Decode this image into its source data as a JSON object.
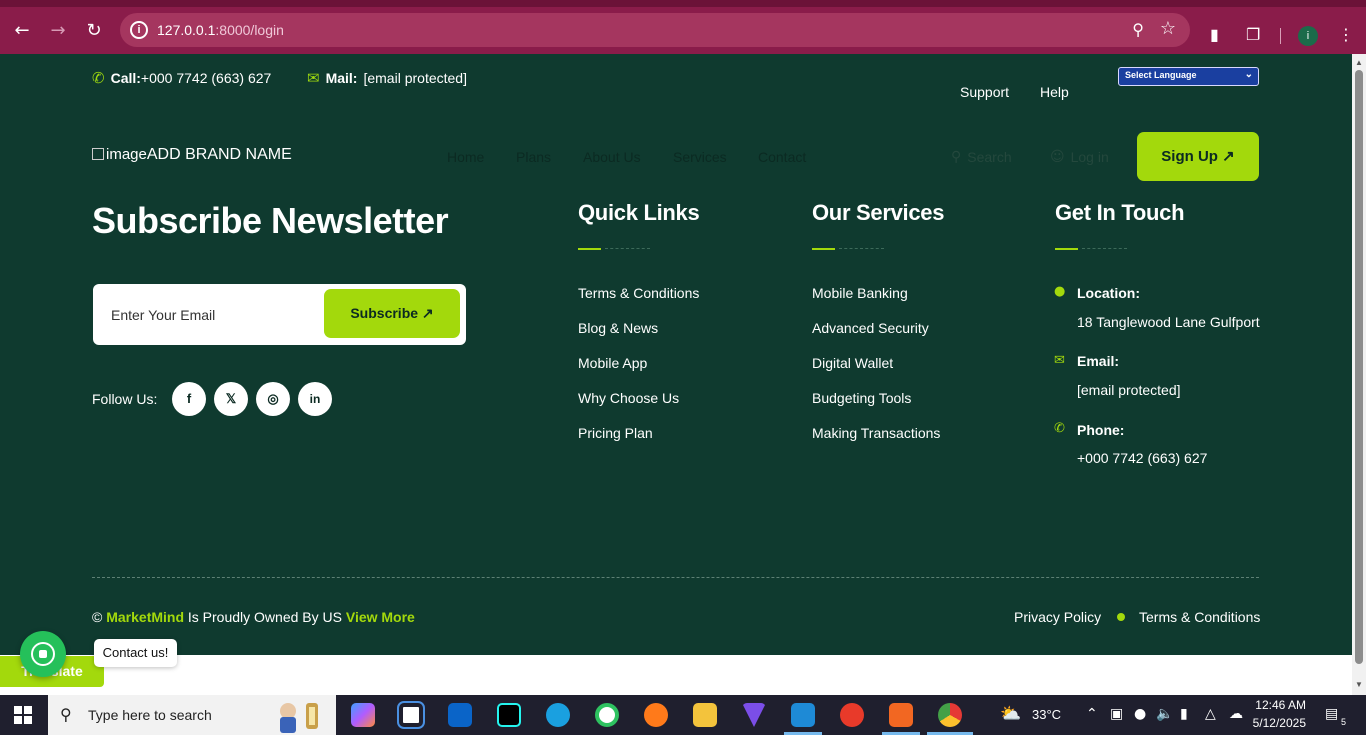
{
  "browser": {
    "url_host": "127.0.0.1",
    "url_path": ":8000/login",
    "profile_initial": "i"
  },
  "topbar": {
    "call_label": "Call:",
    "call_value": "+000 7742 (663) 627",
    "mail_label": "Mail:",
    "mail_value": "[email protected]",
    "support": "Support",
    "help": "Help",
    "language_select": "Select Language"
  },
  "header": {
    "brand_alt": "image",
    "brand_name": "ADD BRAND NAME",
    "nav": [
      "Home",
      "Plans",
      "About Us",
      "Services",
      "Contact"
    ],
    "search": "Search",
    "login": "Log in",
    "signup": "Sign Up ↗"
  },
  "newsletter": {
    "title": "Subscribe Newsletter",
    "email_placeholder": "Enter Your Email",
    "subscribe": "Subscribe ↗",
    "follow_label": "Follow Us:",
    "social": [
      "f",
      "𝕏",
      "◎",
      "in"
    ]
  },
  "quick_links": {
    "title": "Quick Links",
    "items": [
      "Terms & Conditions",
      "Blog & News",
      "Mobile App",
      "Why Choose Us",
      "Pricing Plan"
    ]
  },
  "services": {
    "title": "Our Services",
    "items": [
      "Mobile Banking",
      "Advanced Security",
      "Digital Wallet",
      "Budgeting Tools",
      "Making Transactions"
    ]
  },
  "contact": {
    "title": "Get In Touch",
    "location_label": "Location:",
    "location_value": "18 Tanglewood Lane Gulfport",
    "email_label": "Email:",
    "email_value": "[email protected]",
    "phone_label": "Phone:",
    "phone_value": "+000 7742 (663) 627"
  },
  "footer": {
    "copyright_symbol": "©",
    "company": "MarketMind",
    "owned_text": " Is Proudly Owned By US ",
    "view_more": "View More",
    "privacy": "Privacy Policy",
    "terms": "Terms & Conditions"
  },
  "widgets": {
    "translate": "Translate",
    "whatsapp_tooltip": "Contact us!"
  },
  "taskbar": {
    "search_placeholder": "Type here to search",
    "temperature": "33°C",
    "time": "12:46 AM",
    "date": "5/12/2025",
    "notification_count": "5"
  },
  "colors": {
    "browser_bar": "#8a1c4a",
    "page_bg": "#0f3a2f",
    "accent": "#a3d90c",
    "taskbar": "#1f1f2e"
  }
}
